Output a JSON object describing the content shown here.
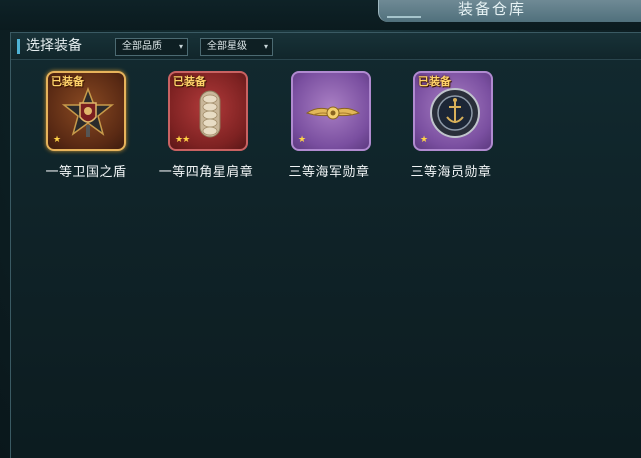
{
  "header": {
    "title": "装备仓库"
  },
  "section": {
    "title": "选择装备"
  },
  "filters": {
    "quality": {
      "selected": "全部品质"
    },
    "star": {
      "selected": "全部星级"
    }
  },
  "items": [
    {
      "name": "一等卫国之盾",
      "badge": "已装备",
      "stars": "★",
      "rarity": "gold",
      "icon": "shield-medal-icon"
    },
    {
      "name": "一等四角星肩章",
      "badge": "已装备",
      "stars": "★★",
      "rarity": "red",
      "icon": "epaulette-icon"
    },
    {
      "name": "三等海军勋章",
      "badge": "",
      "stars": "★",
      "rarity": "purple",
      "icon": "naval-wings-icon"
    },
    {
      "name": "三等海员勋章",
      "badge": "已装备",
      "stars": "★",
      "rarity": "purple",
      "icon": "anchor-medal-icon"
    }
  ],
  "colors": {
    "gold_border": "#e7b35b",
    "red_card": "#7e2222",
    "purple_card": "#7a4fa0",
    "equipped_text": "#ffd36a",
    "star": "#ffd447"
  }
}
